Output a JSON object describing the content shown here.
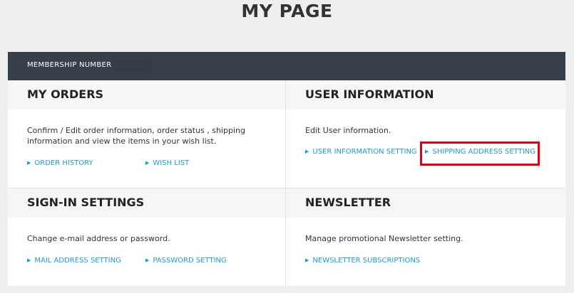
{
  "page": {
    "title": "MY PAGE"
  },
  "membership": {
    "label": "MEMBERSHIP NUMBER :",
    "value": ""
  },
  "panels": {
    "orders": {
      "title": "MY ORDERS",
      "desc": "Confirm / Edit order information, order status , shipping information and view the items in your wish list.",
      "links": [
        "ORDER HISTORY",
        "WISH LIST"
      ]
    },
    "user_info": {
      "title": "USER INFORMATION",
      "desc": "Edit User information.",
      "links": [
        "USER INFORMATION SETTING",
        "SHIPPING ADDRESS SETTING"
      ]
    },
    "signin": {
      "title": "SIGN-IN SETTINGS",
      "desc": "Change e-mail address or password.",
      "links": [
        "MAIL ADDRESS SETTING",
        "PASSWORD SETTING"
      ]
    },
    "newsletter": {
      "title": "NEWSLETTER",
      "desc": "Manage promotional Newsletter setting.",
      "links": [
        "NEWSLETTER SUBSCRIPTIONS"
      ]
    }
  },
  "icons": {
    "link_arrow": "▶"
  },
  "colors": {
    "link": "#1a9bd7",
    "header_bar": "#37404a",
    "highlight": "#e3000f"
  }
}
